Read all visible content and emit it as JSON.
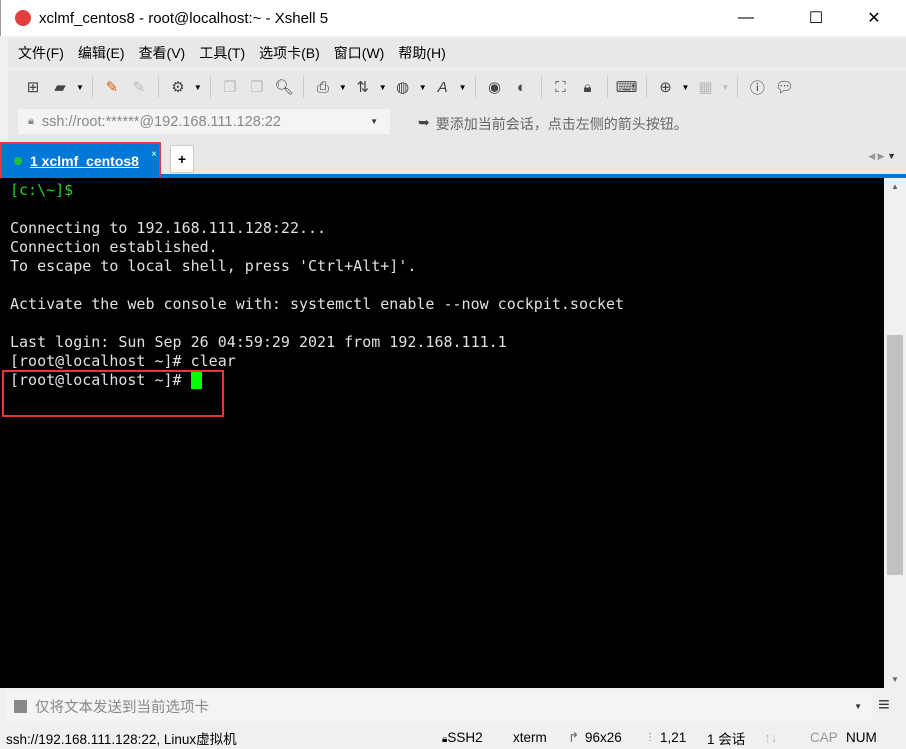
{
  "window": {
    "title": "xclmf_centos8 - root@localhost:~ - Xshell 5",
    "minimize": "—",
    "maximize": "☐",
    "close": "✕"
  },
  "menu": [
    "文件(F)",
    "编辑(E)",
    "查看(V)",
    "工具(T)",
    "选项卡(B)",
    "窗口(W)",
    "帮助(H)"
  ],
  "toolbar": {
    "icons": [
      "new-session",
      "open",
      "reconnect",
      "disconnect",
      "properties",
      "copy",
      "paste",
      "find",
      "print",
      "transfer",
      "globe",
      "font",
      "xftp",
      "xmanager",
      "fullscreen",
      "lock",
      "keyboard",
      "new-tab",
      "layout",
      "help",
      "chat"
    ]
  },
  "address": {
    "value": "ssh://root:******@192.168.111.128:22",
    "hint": "要添加当前会话，点击左侧的箭头按钮。"
  },
  "tab": {
    "label": "1 xclmf_centos8",
    "close": "×",
    "add": "+"
  },
  "terminal": {
    "lines": [
      "[c:\\~]$",
      "",
      "Connecting to 192.168.111.128:22...",
      "Connection established.",
      "To escape to local shell, press 'Ctrl+Alt+]'.",
      "",
      "Activate the web console with: systemctl enable --now cockpit.socket",
      "",
      "Last login: Sun Sep 26 04:59:29 2021 from 192.168.111.1",
      "[root@localhost ~]# clear",
      "[root@localhost ~]# "
    ]
  },
  "send_bar": {
    "placeholder": "仅将文本发送到当前选项卡"
  },
  "status": {
    "connection": "ssh://192.168.111.128:22, Linux虚拟机",
    "protocol": "SSH2",
    "term": "xterm",
    "size": "96x26",
    "cursor": "1,21",
    "sessions": "1 会话",
    "cap": "CAP",
    "num": "NUM"
  }
}
